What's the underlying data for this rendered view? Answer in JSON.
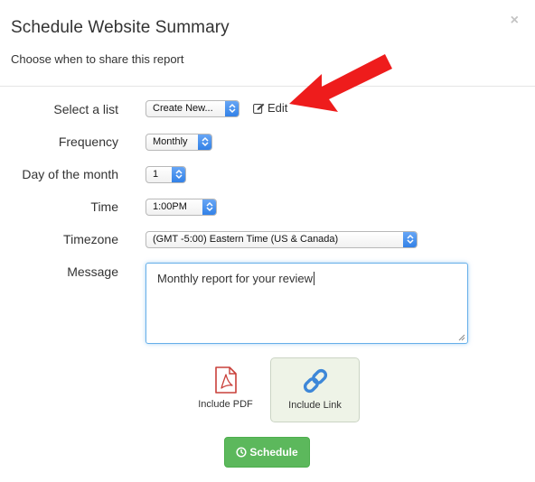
{
  "dialog": {
    "title": "Schedule Website Summary",
    "subtitle": "Choose when to share this report",
    "close_glyph": "×"
  },
  "form": {
    "list": {
      "label": "Select a list",
      "value": "Create New...",
      "edit_label": "Edit"
    },
    "frequency": {
      "label": "Frequency",
      "value": "Monthly"
    },
    "day": {
      "label": "Day of the month",
      "value": "1"
    },
    "time": {
      "label": "Time",
      "value": "1:00PM"
    },
    "timezone": {
      "label": "Timezone",
      "value": "(GMT -5:00) Eastern Time (US & Canada)"
    },
    "message": {
      "label": "Message",
      "value": "Monthly report for your review"
    }
  },
  "options": {
    "pdf": {
      "label": "Include PDF",
      "icon": "pdf-file-icon",
      "selected": false
    },
    "link": {
      "label": "Include Link",
      "icon": "chain-link-icon",
      "selected": true
    }
  },
  "schedule_button": {
    "label": "Schedule",
    "icon": "clock-icon"
  },
  "colors": {
    "annotation_arrow": "#ee1c1c",
    "select_caret": "#2f7fe6",
    "button_green": "#5cb85c",
    "pdf_red": "#c9403a",
    "link_blue": "#3d87d8",
    "selected_option_bg": "#eef3e7"
  }
}
